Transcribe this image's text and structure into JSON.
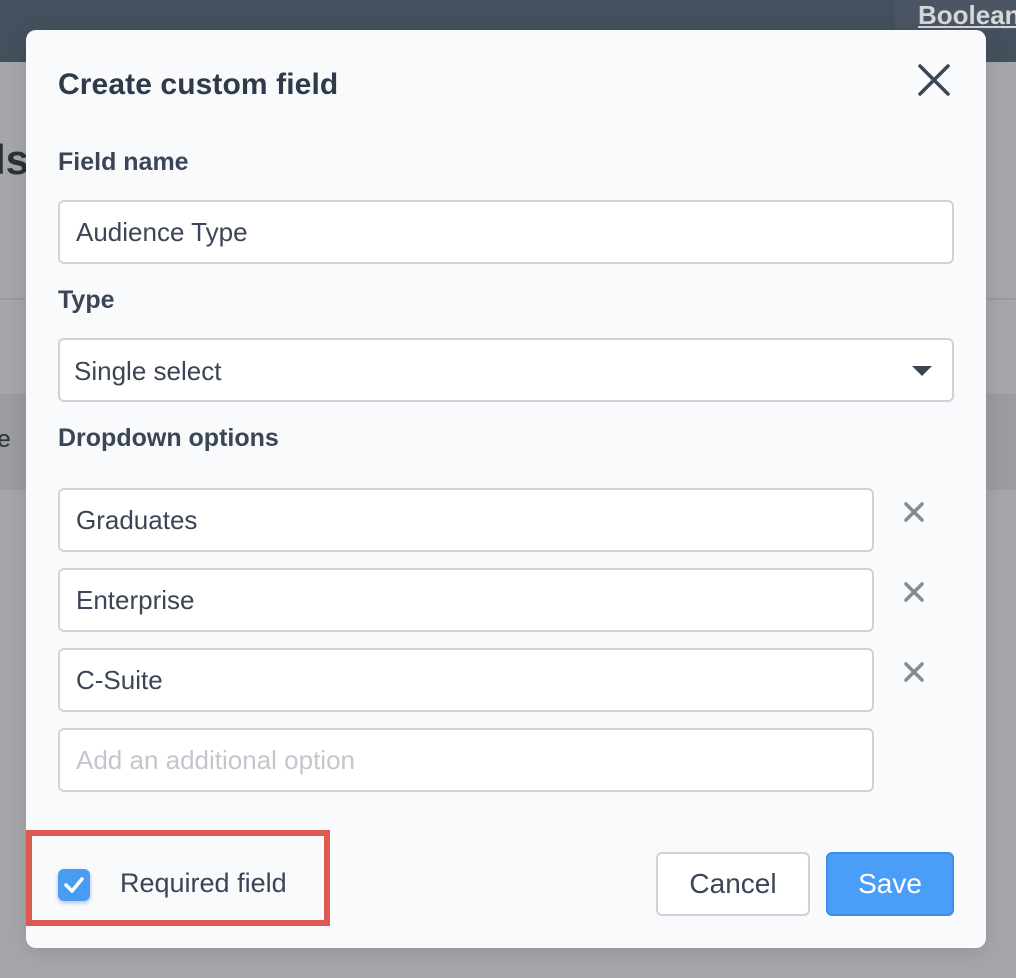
{
  "background": {
    "top_link": "Boolean",
    "heading_fragment": "ds",
    "column_fragment": "le"
  },
  "modal": {
    "title": "Create custom field",
    "close_icon": "close-icon",
    "field_name": {
      "label": "Field name",
      "value": "Audience Type"
    },
    "type": {
      "label": "Type",
      "selected": "Single select",
      "caret_icon": "caret-down-icon"
    },
    "dropdown_options": {
      "label": "Dropdown options",
      "options": [
        "Graduates",
        "Enterprise",
        "C-Suite"
      ],
      "remove_icon": "remove-icon",
      "add_placeholder": "Add an additional option"
    },
    "required": {
      "label": "Required field",
      "checked": true
    },
    "buttons": {
      "cancel": "Cancel",
      "save": "Save"
    }
  },
  "colors": {
    "accent": "#4b9ef7",
    "highlight": "#dc5a52",
    "topbar": "#45505f"
  }
}
